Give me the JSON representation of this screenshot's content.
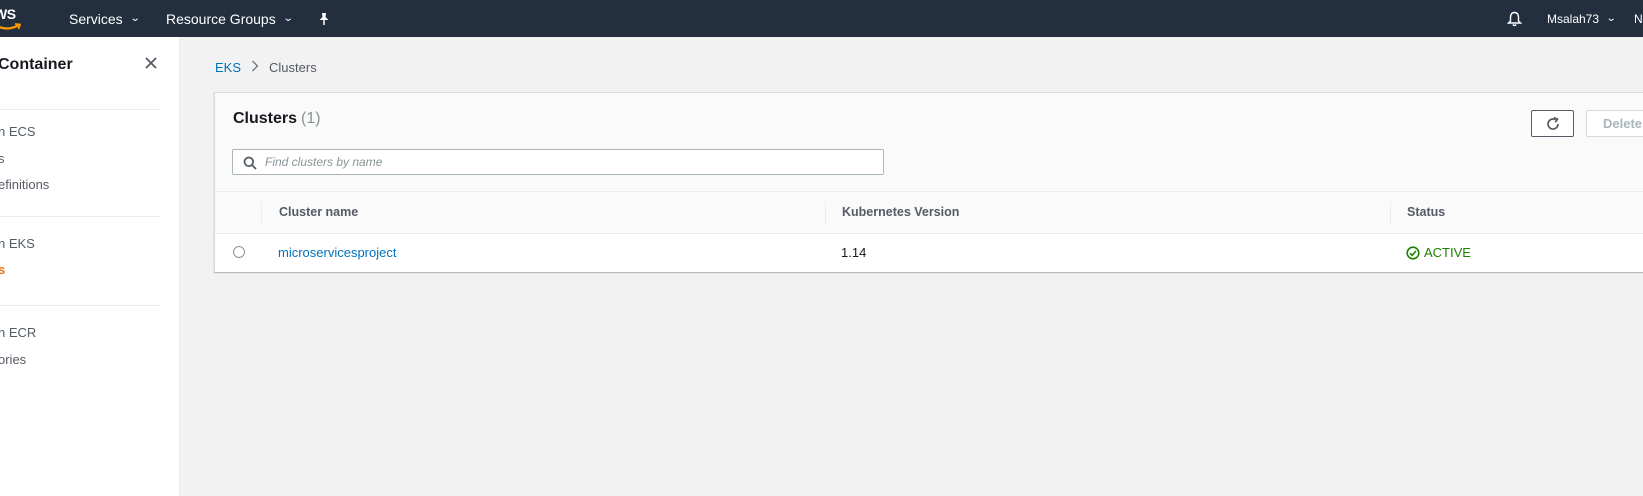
{
  "topnav": {
    "logo_text": "WS",
    "services_label": "Services",
    "resource_groups_label": "Resource Groups",
    "user_label": "Msalah73",
    "region_label": "N"
  },
  "sidebar": {
    "title": "on Container\nces",
    "sections": [
      {
        "items": [
          {
            "label": "n ECS"
          },
          {
            "label": "s"
          },
          {
            "label": "efinitions"
          }
        ]
      },
      {
        "items": [
          {
            "label": "n EKS"
          },
          {
            "label": "s"
          }
        ]
      },
      {
        "items": [
          {
            "label": "n ECR"
          },
          {
            "label": "ories"
          }
        ]
      }
    ]
  },
  "breadcrumb": {
    "root": "EKS",
    "current": "Clusters"
  },
  "panel": {
    "title": "Clusters",
    "count": "(1)",
    "delete_label": "Delete",
    "search_placeholder": "Find clusters by name"
  },
  "table": {
    "columns": [
      "Cluster name",
      "Kubernetes Version",
      "Status"
    ],
    "rows": [
      {
        "name": "microservicesproject",
        "version": "1.14",
        "status": "ACTIVE"
      }
    ]
  },
  "colors": {
    "nav_bg": "#232f3e",
    "link": "#0073bb",
    "active_nav": "#ec7211",
    "status_active": "#1d8102"
  }
}
